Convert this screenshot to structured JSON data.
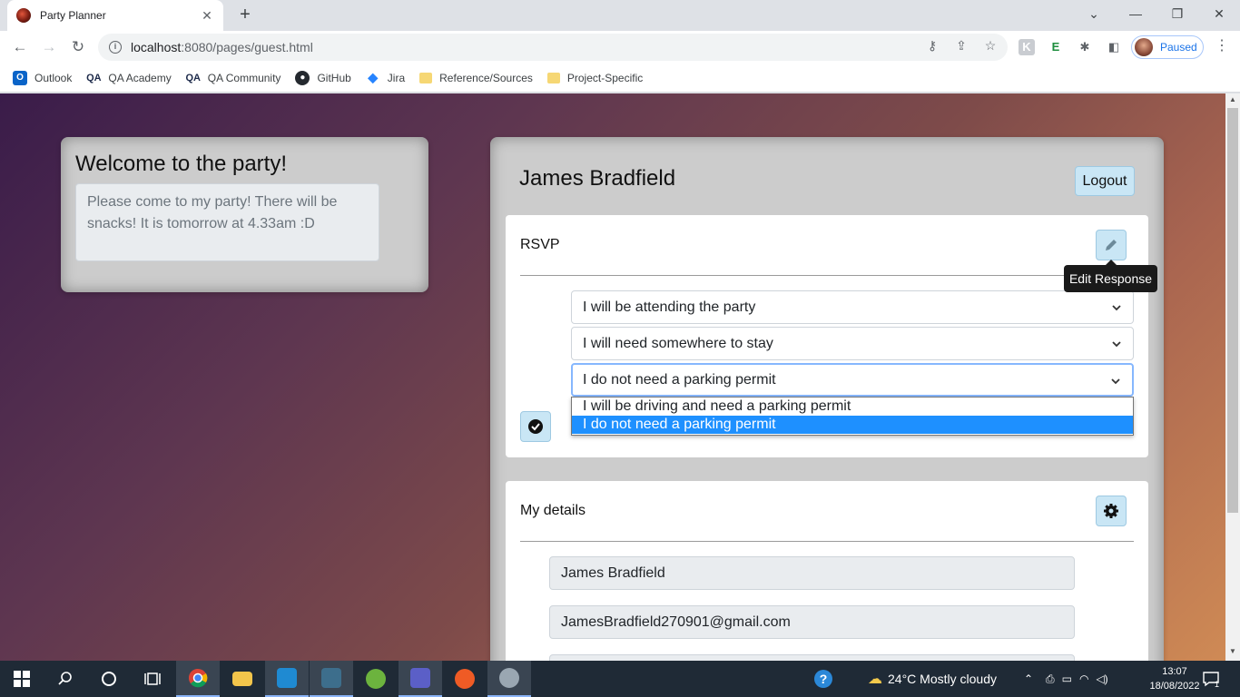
{
  "browser": {
    "tab_title": "Party Planner",
    "url_host": "localhost",
    "url_rest": ":8080/pages/guest.html",
    "profile_status": "Paused"
  },
  "bookmarks": [
    {
      "label": "Outlook",
      "icon": "outlook-icon"
    },
    {
      "label": "QA Academy",
      "icon": "qa-icon"
    },
    {
      "label": "QA Community",
      "icon": "qa-icon"
    },
    {
      "label": "GitHub",
      "icon": "github-icon"
    },
    {
      "label": "Jira",
      "icon": "jira-icon"
    },
    {
      "label": "Reference/Sources",
      "icon": "folder-icon"
    },
    {
      "label": "Project-Specific",
      "icon": "folder-icon"
    }
  ],
  "welcome": {
    "heading": "Welcome to the party!",
    "message": "Please come to my party! There will be snacks! It is tomorrow at 4.33am :D"
  },
  "guest": {
    "name": "James Bradfield",
    "logout_label": "Logout"
  },
  "rsvp": {
    "title": "RSVP",
    "edit_tooltip": "Edit Response",
    "attendance": "I will be attending the party",
    "accommodation": "I will need somewhere to stay",
    "parking": "I do not need a parking permit",
    "parking_options": [
      "I will be driving and need a parking permit",
      "I do not need a parking permit"
    ],
    "parking_selected_index": 1
  },
  "details": {
    "title": "My details",
    "name_value": "James Bradfield",
    "email_value": "JamesBradfield270901@gmail.com"
  },
  "taskbar": {
    "weather": "24°C  Mostly cloudy",
    "time": "13:07",
    "date": "18/08/2022",
    "notification_count": "1"
  },
  "colors": {
    "button_bg": "#c9e6f5",
    "dropdown_highlight": "#1e90ff",
    "page_gradient_start": "#3a1c4a",
    "page_gradient_end": "#cf8a55"
  }
}
